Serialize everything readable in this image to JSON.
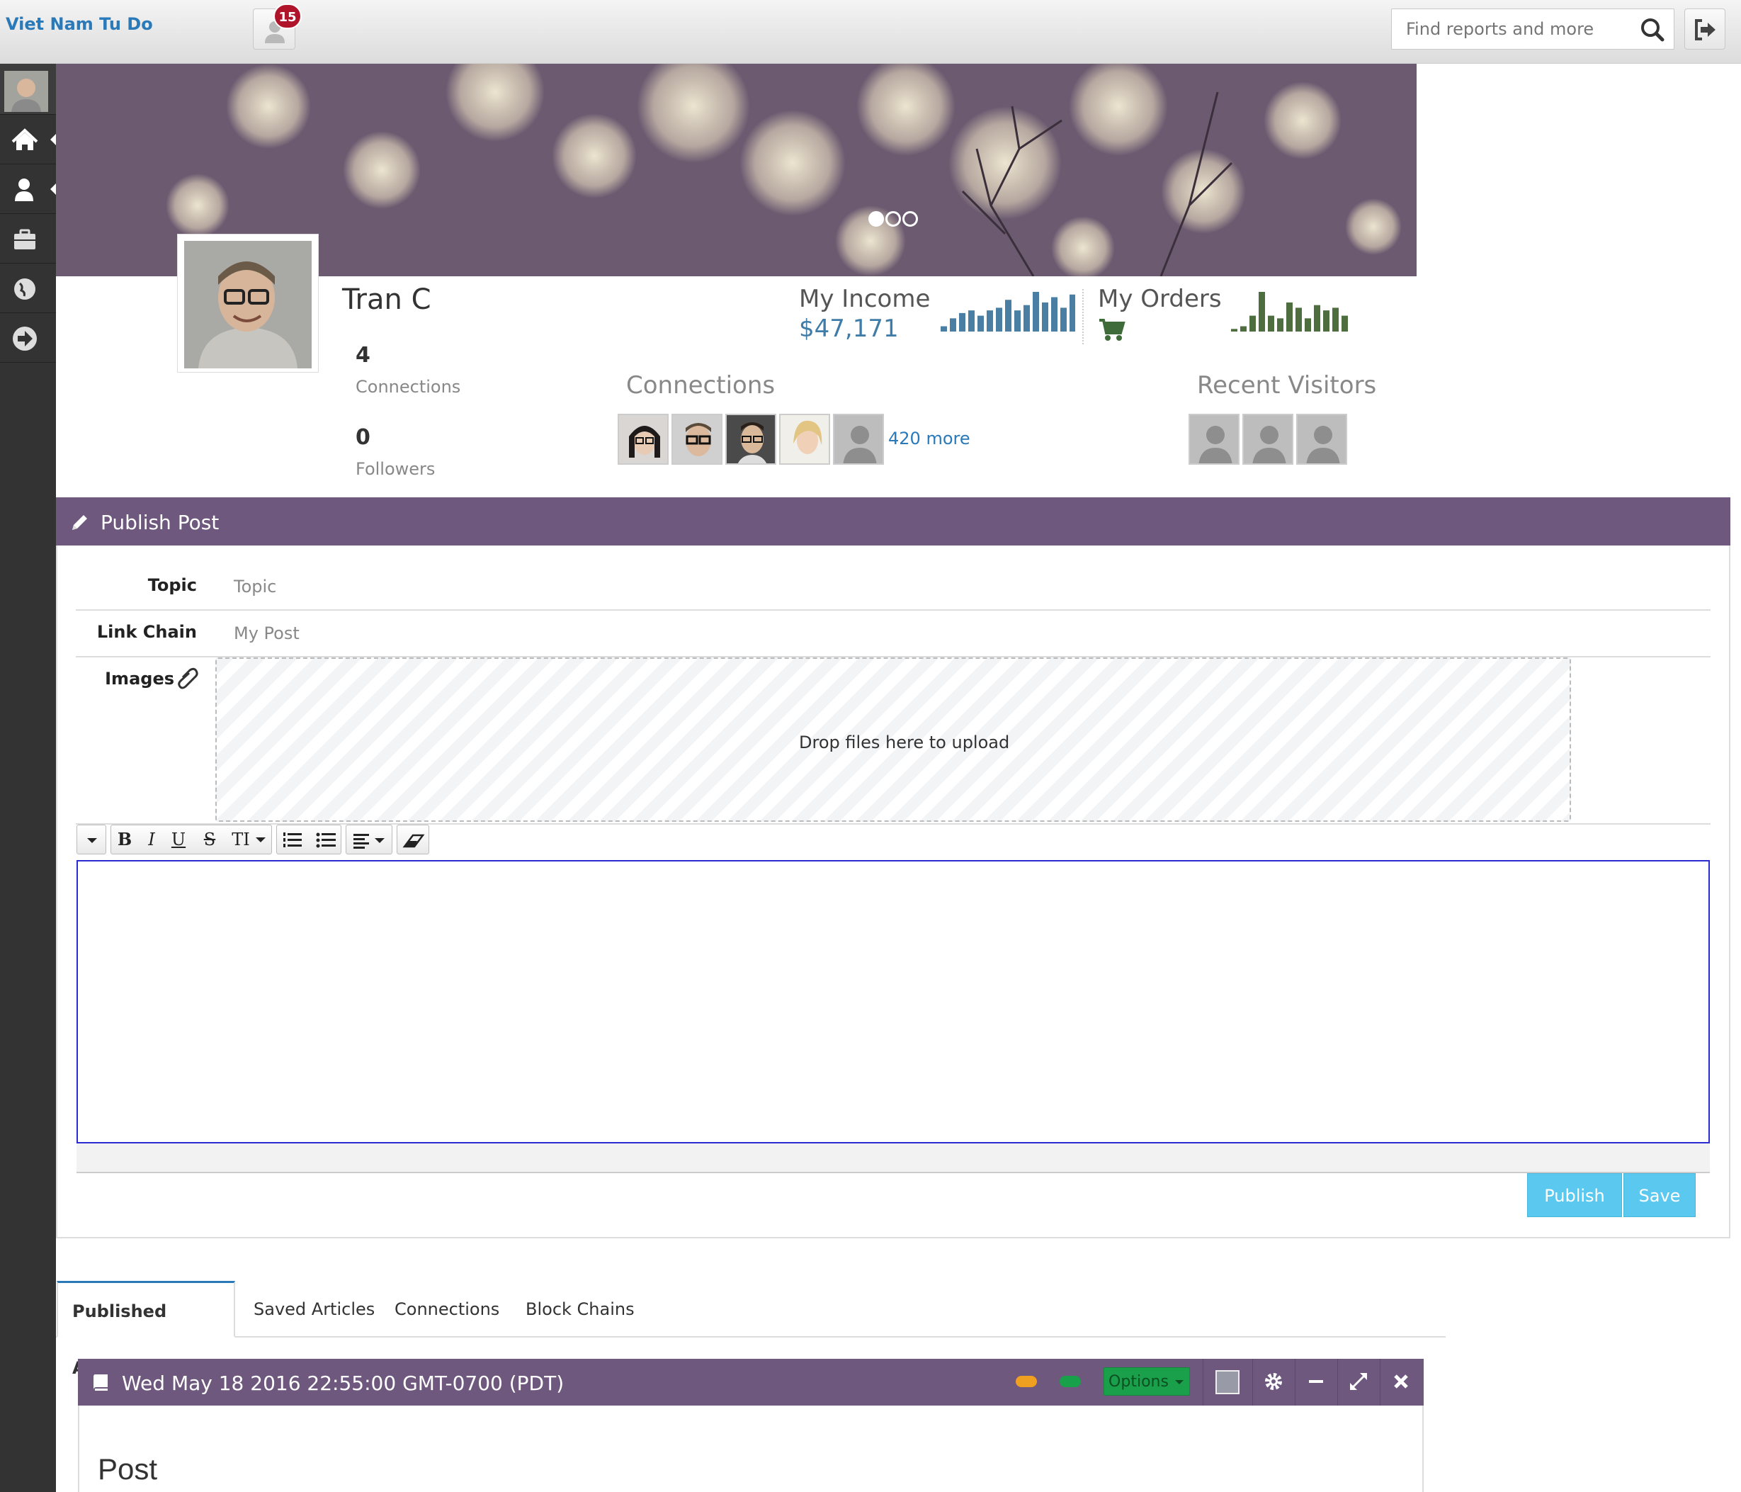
{
  "app": {
    "brand": "Viet Nam Tu Do",
    "notification_count": "15"
  },
  "search": {
    "placeholder": "Find reports and more"
  },
  "sidebar": {
    "items": [
      {
        "name": "avatar"
      },
      {
        "name": "home-icon"
      },
      {
        "name": "user-icon"
      },
      {
        "name": "briefcase-icon"
      },
      {
        "name": "globe-icon"
      },
      {
        "name": "arrow-right-circle-icon"
      }
    ]
  },
  "cover": {
    "slides": 3,
    "active_slide": 1
  },
  "profile": {
    "name": "Tran C",
    "connections_count": "4",
    "connections_label": "Connections",
    "followers_count": "0",
    "followers_label": "Followers"
  },
  "kpi": {
    "income_title": "My Income",
    "income_value": "$47,171",
    "income_spark": [
      2,
      5,
      7,
      8,
      6,
      8,
      9,
      12,
      8,
      10,
      15,
      11,
      13,
      9,
      14
    ],
    "orders_title": "My Orders",
    "orders_spark": [
      1,
      2,
      6,
      15,
      6,
      5,
      11,
      9,
      5,
      10,
      8,
      9,
      6
    ],
    "colors": {
      "income": "#4a7fa3",
      "orders": "#4f6e3f"
    }
  },
  "connections": {
    "title": "Connections",
    "more": "420 more"
  },
  "recent_visitors": {
    "title": "Recent Visitors"
  },
  "publish_post": {
    "title": "Publish Post",
    "topic_label": "Topic",
    "topic_placeholder": "Topic",
    "link_label": "Link Chain",
    "link_placeholder": "My Post",
    "images_label": "Images",
    "dropzone_text": "Drop files here to upload",
    "toolbar": {
      "bold": "B",
      "italic": "I",
      "underline": "U",
      "strike": "S",
      "textsize": "TI"
    },
    "publish_label": "Publish",
    "save_label": "Save"
  },
  "tabs": [
    {
      "label": "Published Articles",
      "active": true
    },
    {
      "label": "Saved Articles"
    },
    {
      "label": "Connections"
    },
    {
      "label": "Block Chains"
    }
  ],
  "article": {
    "title": "Wed May 18 2016 22:55:00 GMT-0700 (PDT)",
    "options_label": "Options",
    "body_heading": "Post"
  },
  "colors": {
    "accent": "#6e587e",
    "link": "#2a79b8",
    "cyan": "#5bc8f0"
  }
}
